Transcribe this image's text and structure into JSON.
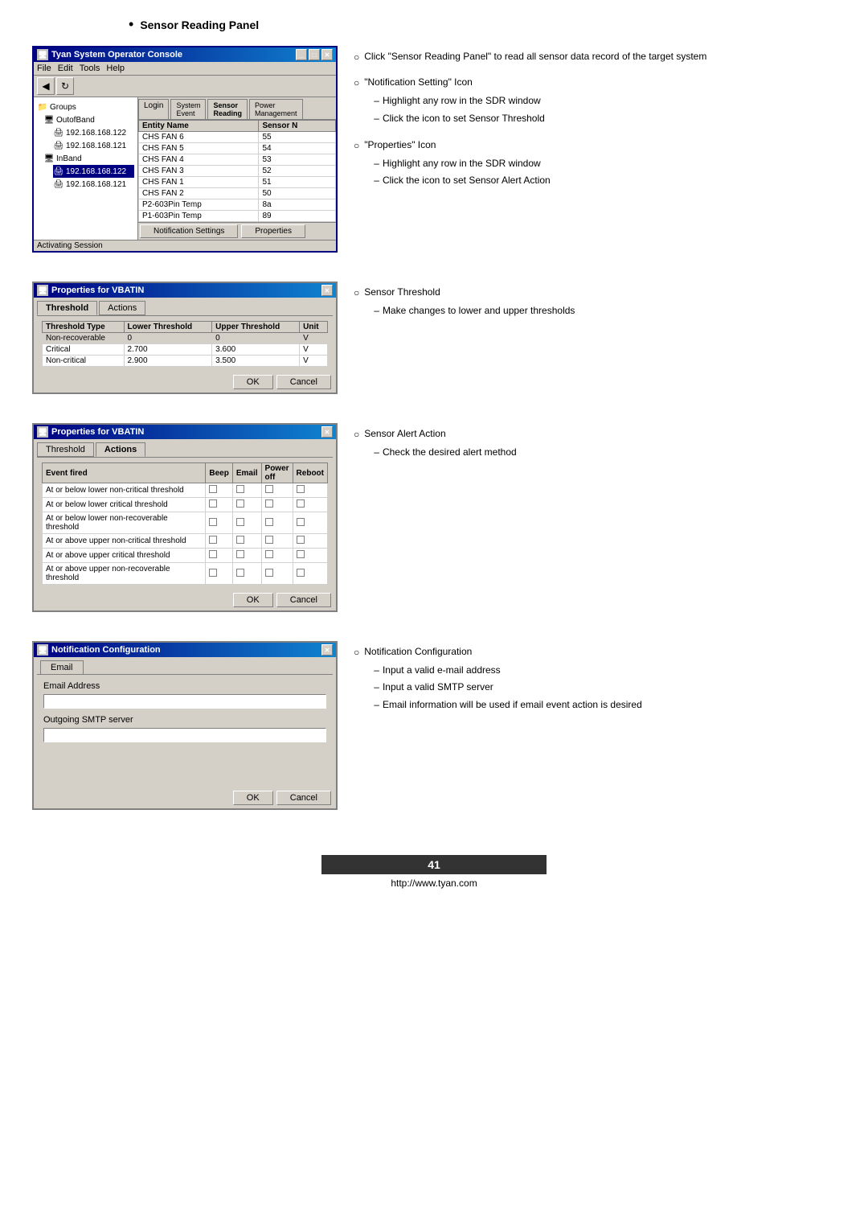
{
  "section": {
    "title": "Sensor Reading Panel",
    "bullet": "•"
  },
  "main_window": {
    "title": "Tyan System Operator Console",
    "menu_items": [
      "File",
      "Edit",
      "Tools",
      "Help"
    ],
    "tabs": [
      "Login",
      "System\nEvent",
      "Sensor\nReading",
      "Power\nManagement"
    ],
    "sidebar": {
      "groups_label": "Groups",
      "outofband": {
        "label": "OutofBand",
        "children": [
          "192.168.168.122",
          "192.168.168.121"
        ]
      },
      "inband": {
        "label": "InBand",
        "children": [
          "192.168.168.122",
          "192.168.168.121"
        ]
      }
    },
    "sensor_table": {
      "headers": [
        "Entity Name",
        "Sensor N"
      ],
      "rows": [
        {
          "name": "CHS FAN 6",
          "value": "55"
        },
        {
          "name": "CHS FAN 5",
          "value": "54"
        },
        {
          "name": "CHS FAN 4",
          "value": "53"
        },
        {
          "name": "CHS FAN 3",
          "value": "52"
        },
        {
          "name": "CHS FAN 1",
          "value": "51"
        },
        {
          "name": "CHS FAN 2",
          "value": "50"
        },
        {
          "name": "P2-603Pin Temp",
          "value": "8a"
        },
        {
          "name": "P1-603Pin Temp",
          "value": "89"
        }
      ],
      "bottom_buttons": [
        "Notification Settings",
        "Properties"
      ]
    },
    "status": "Activating Session"
  },
  "threshold_dialog": {
    "title": "Properties for VBATIN",
    "tabs": [
      "Threshold",
      "Actions"
    ],
    "active_tab": "Threshold",
    "table": {
      "headers": [
        "Threshold Type",
        "Lower Threshold",
        "Upper Threshold",
        "Unit"
      ],
      "rows": [
        {
          "type": "Non-recoverable",
          "lower": "0",
          "upper": "0",
          "unit": "V"
        },
        {
          "type": "Critical",
          "lower": "2.700",
          "upper": "3.600",
          "unit": "V"
        },
        {
          "type": "Non-critical",
          "lower": "2.900",
          "upper": "3.500",
          "unit": "V"
        }
      ]
    },
    "buttons": [
      "OK",
      "Cancel"
    ]
  },
  "actions_dialog": {
    "title": "Properties for VBATIN",
    "tabs": [
      "Threshold",
      "Actions"
    ],
    "active_tab": "Actions",
    "table": {
      "headers": [
        "Event fired",
        "Beep",
        "Email",
        "Power off",
        "Reboot"
      ],
      "rows": [
        "At or below lower non-critical threshold",
        "At or below lower critical threshold",
        "At or below lower non-recoverable threshold",
        "At or above upper non-critical threshold",
        "At or above upper critical threshold",
        "At or above upper non-recoverable threshold"
      ]
    },
    "buttons": [
      "OK",
      "Cancel"
    ]
  },
  "notification_dialog": {
    "title": "Notification Configuration",
    "tabs": [
      "Email"
    ],
    "active_tab": "Email",
    "email_label": "Email Address",
    "smtp_label": "Outgoing SMTP server",
    "buttons": [
      "OK",
      "Cancel"
    ]
  },
  "descriptions": [
    {
      "main": "Click \"Sensor Reading Panel\" to read all sensor data record of the target system",
      "sub": []
    },
    {
      "main": "\"Notification Setting\" Icon",
      "sub": [
        "Highlight any row in the SDR window",
        "Click the icon to set Sensor Threshold"
      ]
    },
    {
      "main": "\"Properties\" Icon",
      "sub": [
        "Highlight any row in the SDR window",
        "Click the icon to set Sensor Alert Action"
      ]
    },
    {
      "main": "Sensor Threshold",
      "sub": [
        "Make changes to lower and upper thresholds"
      ]
    },
    {
      "main": "Sensor Alert Action",
      "sub": [
        "Check the desired alert method"
      ]
    },
    {
      "main": "Notification Configuration",
      "sub": [
        "Input a valid e-mail address",
        "Input a valid SMTP server",
        "Email information will be used if email event action is desired"
      ]
    }
  ],
  "footer": {
    "page_number": "41",
    "url": "http://www.tyan.com"
  }
}
